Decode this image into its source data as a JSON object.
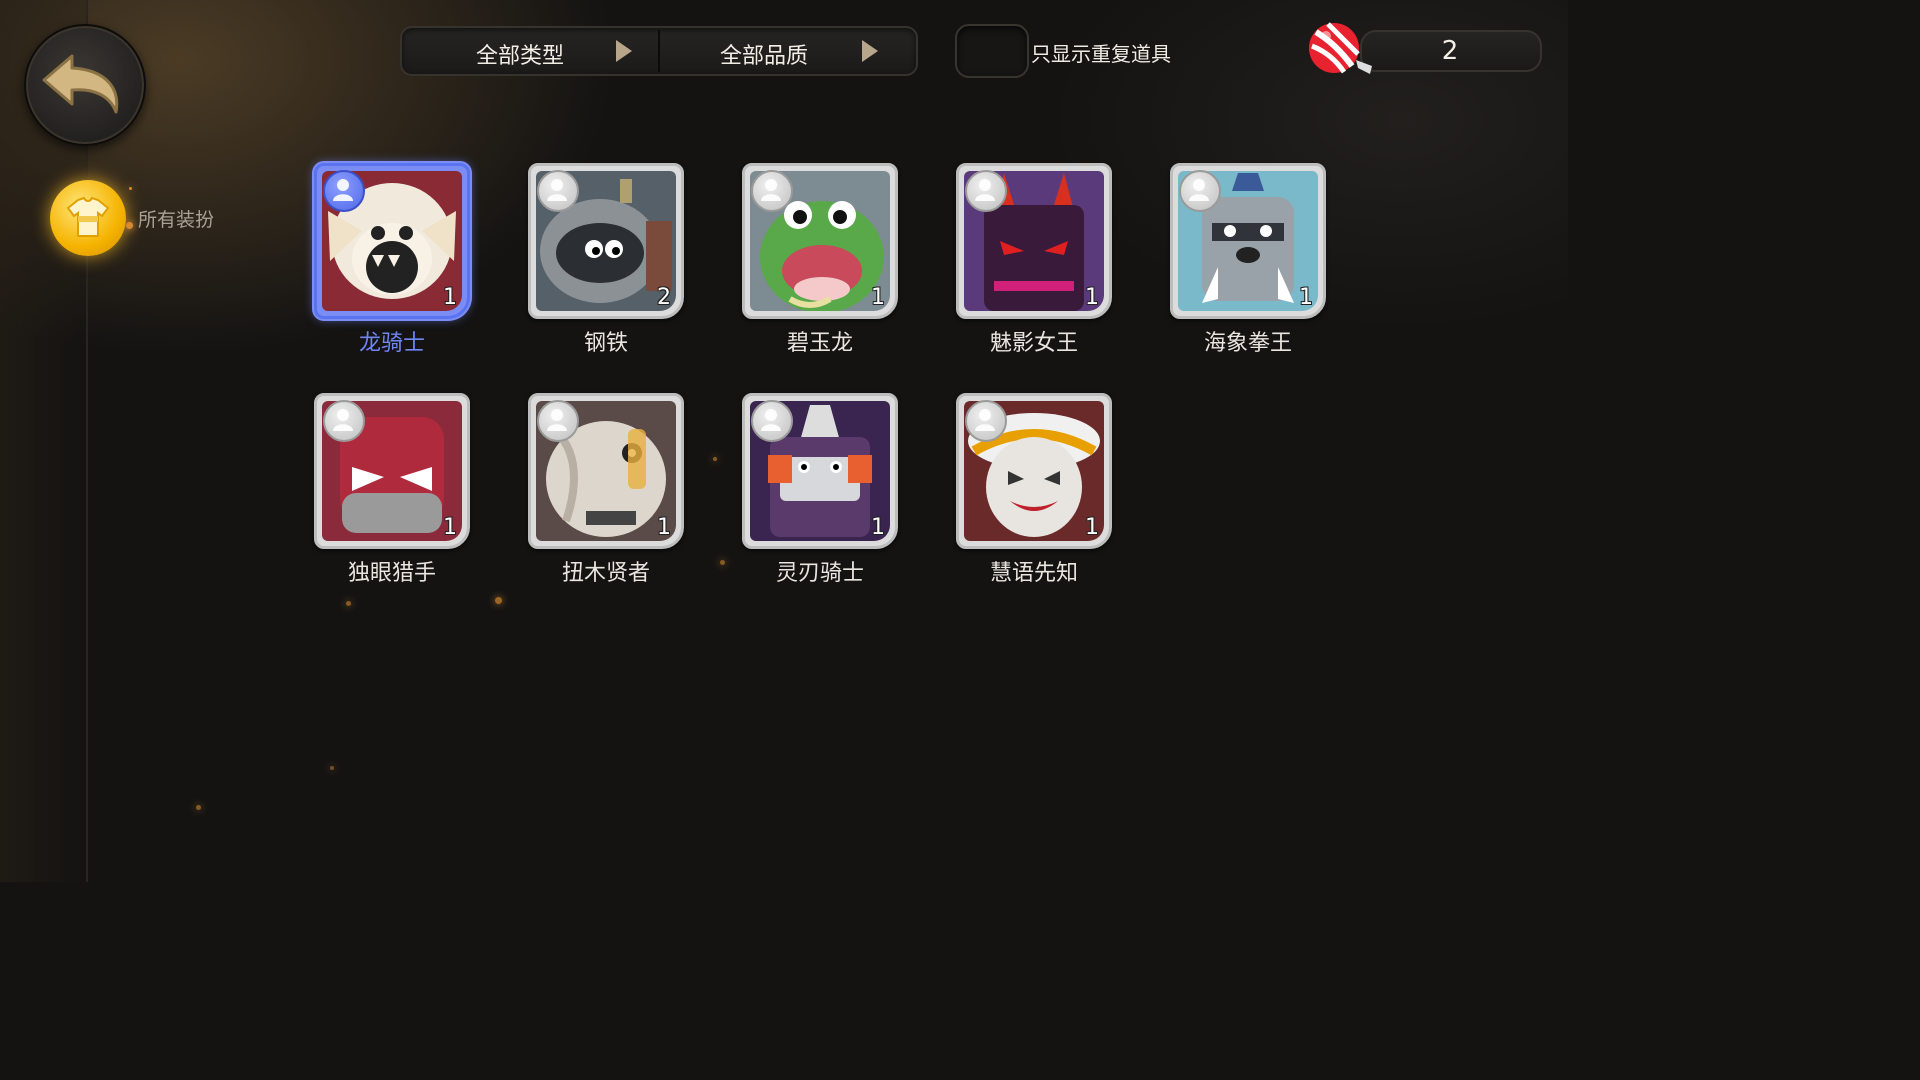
{
  "header": {
    "filters": [
      {
        "label": "全部类型",
        "icon": "triangle-right-icon"
      },
      {
        "label": "全部品质",
        "icon": "triangle-right-icon"
      }
    ],
    "toggle_label": "只显示重复道具",
    "currency": {
      "icon": "candy-icon",
      "value": "2"
    }
  },
  "sidebar": {
    "back_icon": "back-arrow-icon",
    "category": {
      "icon": "outfit-icon",
      "label": "所有装扮"
    }
  },
  "items": [
    {
      "name": "龙骑士",
      "count": "1",
      "selected": true
    },
    {
      "name": "钢铁",
      "count": "2",
      "selected": false
    },
    {
      "name": "碧玉龙",
      "count": "1",
      "selected": false
    },
    {
      "name": "魅影女王",
      "count": "1",
      "selected": false
    },
    {
      "name": "海象拳王",
      "count": "1",
      "selected": false
    },
    {
      "name": "独眼猎手",
      "count": "1",
      "selected": false
    },
    {
      "name": "扭木贤者",
      "count": "1",
      "selected": false
    },
    {
      "name": "灵刃骑士",
      "count": "1",
      "selected": false
    },
    {
      "name": "慧语先知",
      "count": "1",
      "selected": false
    }
  ],
  "colors": {
    "selected_accent": "#6f86f6",
    "glow_gold": "#f5b300"
  }
}
